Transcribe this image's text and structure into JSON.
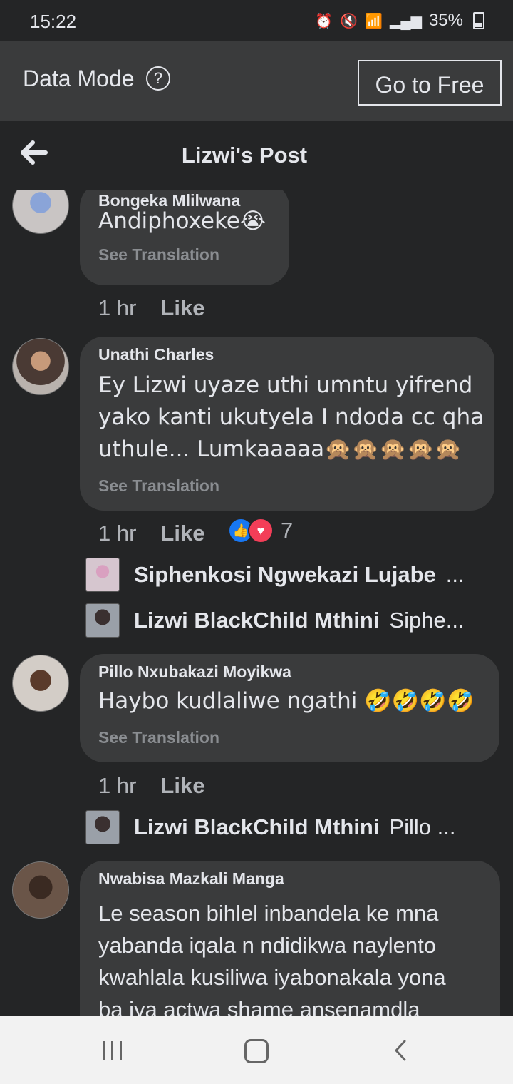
{
  "status_bar": {
    "time": "15:22",
    "battery": "35%",
    "icons": [
      "alarm-icon",
      "mute-icon",
      "wifi-icon",
      "4g-icon",
      "signal-icon",
      "battery-icon"
    ]
  },
  "data_mode": {
    "label": "Data Mode",
    "help_icon": "?",
    "go_free_label": "Go to Free"
  },
  "header": {
    "title": "Lizwi's Post",
    "back_icon": "arrow-left-icon"
  },
  "comments": [
    {
      "author": "Bongeka Mlilwana",
      "text": "Andiphoxeke😭",
      "see_translation": "See Translation",
      "time": "1 hr",
      "like_label": "Like"
    },
    {
      "author": "Unathi Charles",
      "text_lines": [
        "Ey Lizwi uyaze uthi umntu yifrend",
        "yako kanti ukutyela I ndoda cc qha",
        "uthule... Lumkaaaaa🙊🙊🙊🙊🙊"
      ],
      "see_translation": "See Translation",
      "time": "1 hr",
      "like_label": "Like",
      "reaction_count": "7",
      "replies": [
        {
          "name": "Siphenkosi Ngwekazi Lujabe",
          "snippet": "..."
        },
        {
          "name": "Lizwi BlackChild Mthini",
          "snippet": "Siphe..."
        }
      ]
    },
    {
      "author": "Pillo Nxubakazi Moyikwa",
      "text": "Haybo kudlaliwe ngathi 🤣🤣🤣🤣",
      "see_translation": "See Translation",
      "time": "1 hr",
      "like_label": "Like",
      "replies": [
        {
          "name": "Lizwi BlackChild Mthini",
          "snippet": "Pillo ..."
        }
      ]
    },
    {
      "author": "Nwabisa Mazkali Manga",
      "text_lines": [
        "Le season bihlel inbandela ke mna",
        "yabanda iqala n ndidikwa naylento",
        "kwahlala kusiliwa  iyabonakala yona",
        "ba iya actwa shame ansenamdla"
      ]
    }
  ],
  "nav_bar": {
    "icons": [
      "recent-apps-icon",
      "home-icon",
      "back-icon"
    ]
  }
}
